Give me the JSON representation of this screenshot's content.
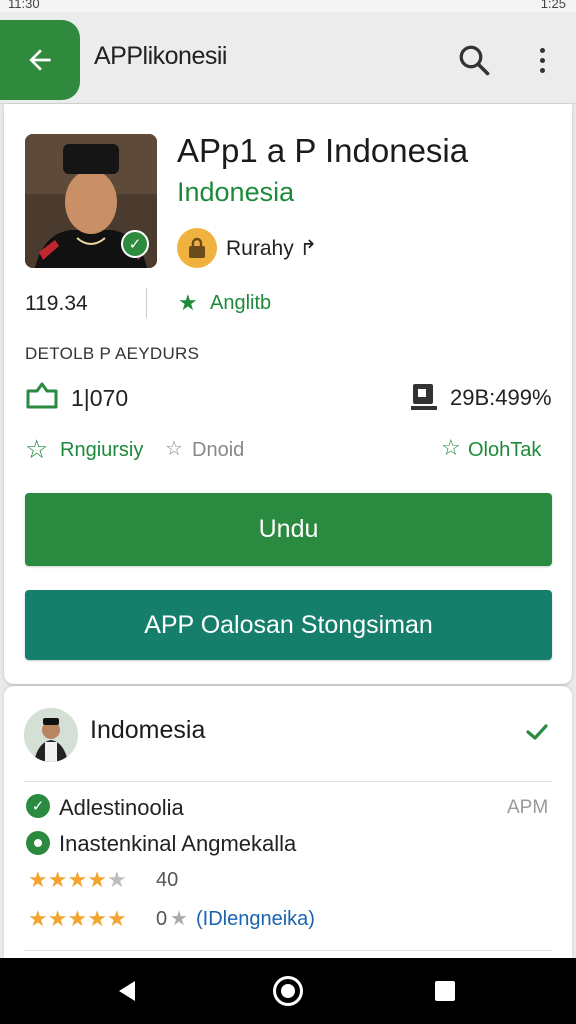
{
  "status_bar": {
    "left": "11:30",
    "right": "1:25"
  },
  "app_bar": {
    "title": "APPlikonesii"
  },
  "app": {
    "name": "APp1 a P Indonesia",
    "developer": "Indonesia",
    "rating_label": "Rurahy ↱",
    "count": "119.34",
    "badge": "Anglitb"
  },
  "details": {
    "heading": "DETOLB P AEYDURS",
    "installs": "1|070",
    "size": "29B:499%",
    "tags": [
      "Rngiursiy",
      "Dnoid",
      "OlohTak"
    ]
  },
  "buttons": {
    "install": "Undu",
    "secondary": "APP Oalosan Stongsiman"
  },
  "developer_card": {
    "name": "Indomesia",
    "features": [
      {
        "label": "Adlestinoolia",
        "tag": "APM"
      },
      {
        "label": "Inastenkinal Angmekalla"
      }
    ],
    "ratings": [
      {
        "stars": 4,
        "value": "40"
      },
      {
        "stars": 5,
        "value": "0",
        "extra": "★",
        "link": "(IDlengneika)"
      }
    ]
  },
  "colors": {
    "brand_green": "#2a8a3f",
    "teal": "#167f6c",
    "star": "#f2a531"
  }
}
